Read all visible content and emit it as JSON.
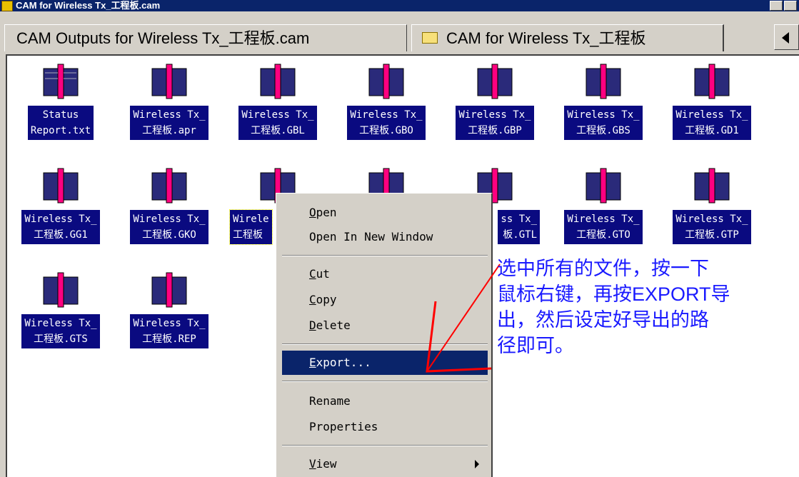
{
  "window": {
    "title": "CAM for Wireless Tx_工程板.cam"
  },
  "tabs": [
    {
      "label": "CAM Outputs for Wireless Tx_工程板.cam"
    },
    {
      "label": "CAM for Wireless Tx_工程板"
    }
  ],
  "files": [
    {
      "line1": "Status",
      "line2": "Report.txt"
    },
    {
      "line1": "Wireless Tx_",
      "line2": "工程板.apr"
    },
    {
      "line1": "Wireless Tx_",
      "line2": "工程板.GBL"
    },
    {
      "line1": "Wireless Tx_",
      "line2": "工程板.GBO"
    },
    {
      "line1": "Wireless Tx_",
      "line2": "工程板.GBP"
    },
    {
      "line1": "Wireless Tx_",
      "line2": "工程板.GBS"
    },
    {
      "line1": "Wireless Tx_",
      "line2": "工程板.GD1"
    },
    {
      "line1": "Wireless Tx_",
      "line2": "工程板.GG1"
    },
    {
      "line1": "Wireless Tx_",
      "line2": "工程板.GKO"
    },
    {
      "line1": "Wirele",
      "line2": "工程板"
    },
    {
      "line1": "",
      "line2": ""
    },
    {
      "line1": "ss Tx_",
      "line2": "板.GTL"
    },
    {
      "line1": "Wireless Tx_",
      "line2": "工程板.GTO"
    },
    {
      "line1": "Wireless Tx_",
      "line2": "工程板.GTP"
    },
    {
      "line1": "Wireless Tx_",
      "line2": "工程板.GTS"
    },
    {
      "line1": "Wireless Tx_",
      "line2": "工程板.REP"
    }
  ],
  "context_menu": {
    "open": {
      "accel": "O",
      "rest": "pen"
    },
    "open_new_window": "Open In New Window",
    "cut": {
      "accel": "C",
      "rest": "ut"
    },
    "copy": {
      "accel": "C",
      "rest": "opy"
    },
    "delete": {
      "accel": "D",
      "rest": "elete"
    },
    "export": {
      "accel": "E",
      "rest": "xport..."
    },
    "rename": "Rename",
    "properties": "Properties",
    "view": {
      "accel": "V",
      "rest": "iew"
    }
  },
  "annotation": {
    "text": "选中所有的文件，按一下\n鼠标右键，再按EXPORT导\n出，然后设定好导出的路\n径即可。",
    "color": "#1a1aff",
    "arrow_color": "#ff0000"
  },
  "colors": {
    "selection": "#0a0a80",
    "menu_highlight": "#0a246a",
    "chrome": "#d4d0c8"
  }
}
